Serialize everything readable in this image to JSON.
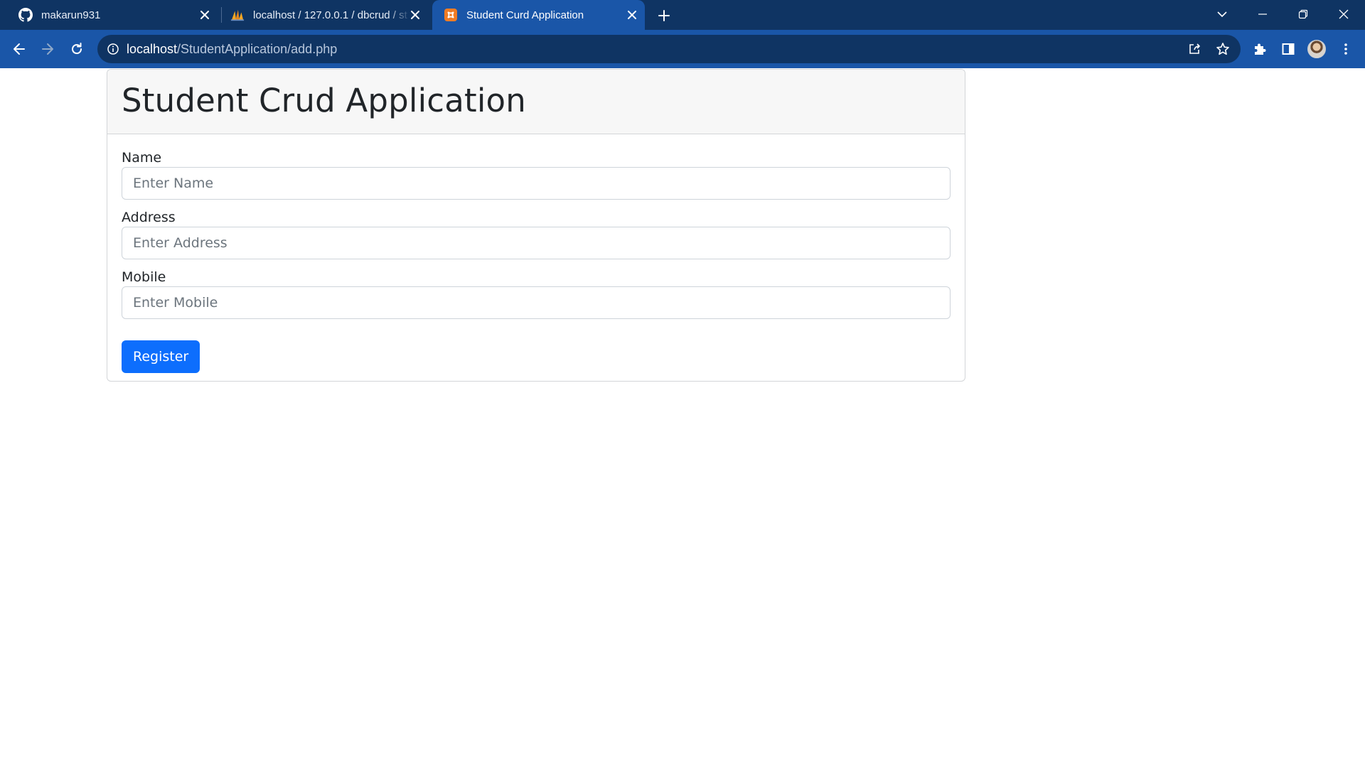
{
  "browser": {
    "tabs": [
      {
        "title": "makarun931",
        "icon": "github-icon"
      },
      {
        "title": "localhost / 127.0.0.1 / dbcrud / st",
        "icon": "phpmyadmin-icon"
      },
      {
        "title": "Student Curd Application",
        "icon": "xampp-icon",
        "active": true
      }
    ],
    "url_host": "localhost",
    "url_path": "/StudentApplication/add.php"
  },
  "page": {
    "heading": "Student Crud Application",
    "form": {
      "name_label": "Name",
      "name_placeholder": "Enter Name",
      "address_label": "Address",
      "address_placeholder": "Enter Address",
      "mobile_label": "Mobile",
      "mobile_placeholder": "Enter Mobile",
      "submit_label": "Register"
    }
  },
  "colors": {
    "tabstrip": "#0f3463",
    "toolbar": "#1a56a8",
    "primary_button": "#0d6efd"
  }
}
